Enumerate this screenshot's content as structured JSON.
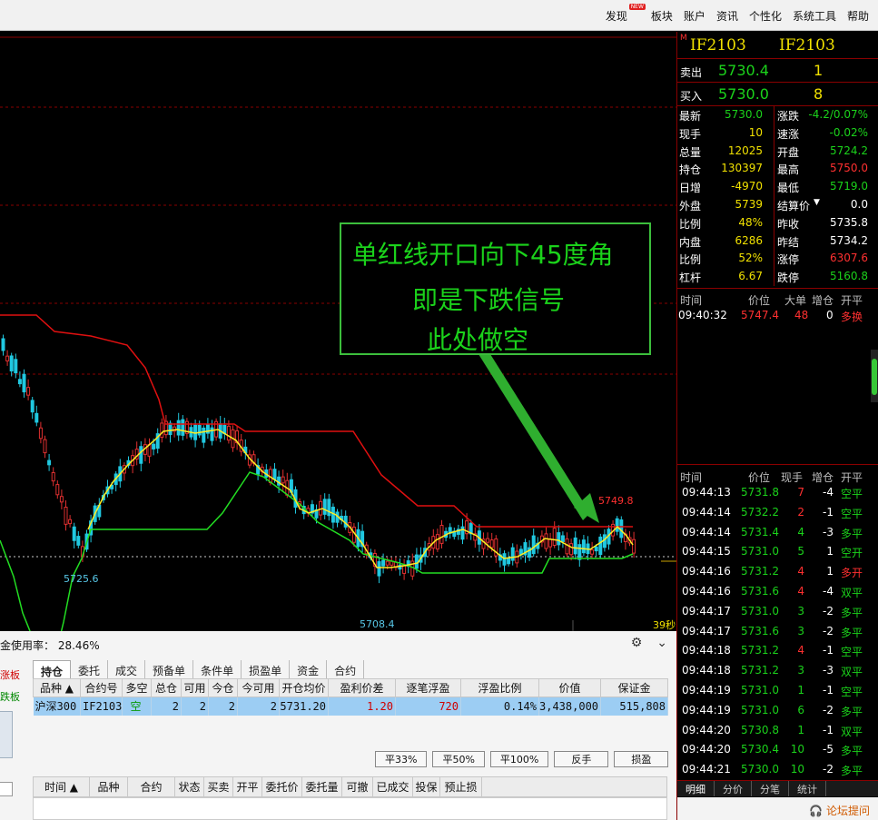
{
  "menu": [
    "发现",
    "板块",
    "账户",
    "资讯",
    "个性化",
    "系统工具",
    "帮助"
  ],
  "new_badge": "NEW",
  "chart": {
    "annotation": [
      "单红线开口向下45度角",
      "即是下跌信号",
      "此处做空"
    ],
    "labels": {
      "high": "5749.8",
      "low_left": "5725.6",
      "low_mid": "5708.4",
      "countdown": "39秒"
    }
  },
  "quote": {
    "market_flag": "M",
    "code1": "IF2103",
    "code2": "IF2103",
    "sell": {
      "label": "卖出",
      "price": "5730.4",
      "volume": "1"
    },
    "buy": {
      "label": "买入",
      "price": "5730.0",
      "volume": "8"
    },
    "stats": [
      {
        "l1": "最新",
        "v1": "5730.0",
        "c1": "#1bd21b",
        "l2": "涨跌",
        "v2": "-4.2/0.07%",
        "c2": "#1bd21b"
      },
      {
        "l1": "现手",
        "v1": "10",
        "c1": "#f0e000",
        "l2": "速涨",
        "v2": "-0.02%",
        "c2": "#1bd21b"
      },
      {
        "l1": "总量",
        "v1": "12025",
        "c1": "#f0e000",
        "l2": "开盘",
        "v2": "5724.2",
        "c2": "#1bd21b"
      },
      {
        "l1": "持仓",
        "v1": "130397",
        "c1": "#f0e000",
        "l2": "最高",
        "v2": "5750.0",
        "c2": "#ff3030"
      },
      {
        "l1": "日增",
        "v1": "-4970",
        "c1": "#f0e000",
        "l2": "最低",
        "v2": "5719.0",
        "c2": "#1bd21b"
      },
      {
        "l1": "外盘",
        "v1": "5739",
        "c1": "#f0e000",
        "l2": "结算价",
        "v2": "0.0",
        "c2": "#ffffff"
      },
      {
        "l1": "比例",
        "v1": "48%",
        "c1": "#f0e000",
        "l2": "昨收",
        "v2": "5735.8",
        "c2": "#ffffff"
      },
      {
        "l1": "内盘",
        "v1": "6286",
        "c1": "#f0e000",
        "l2": "昨结",
        "v2": "5734.2",
        "c2": "#ffffff"
      },
      {
        "l1": "比例",
        "v1": "52%",
        "c1": "#f0e000",
        "l2": "涨停",
        "v2": "6307.6",
        "c2": "#ff3030"
      },
      {
        "l1": "杠杆",
        "v1": "6.67",
        "c1": "#f0e000",
        "l2": "跌停",
        "v2": "5160.8",
        "c2": "#1bd21b"
      }
    ],
    "big_header": [
      "时间",
      "价位",
      "大单",
      "增仓",
      "开平"
    ],
    "big_row": {
      "time": "09:40:32",
      "price": "5747.4",
      "vol": "48",
      "inc": "0",
      "type": "多换"
    },
    "tick_header": [
      "时间",
      "价位",
      "现手",
      "增仓",
      "开平"
    ],
    "ticks": [
      {
        "time": "09:44:13",
        "price": "5731.8",
        "vol": "7",
        "inc": "-4",
        "type": "空平",
        "vc": "#ff3030",
        "tc": "#1bd21b"
      },
      {
        "time": "09:44:14",
        "price": "5732.2",
        "vol": "2",
        "inc": "-1",
        "type": "空平",
        "vc": "#ff3030",
        "tc": "#1bd21b"
      },
      {
        "time": "09:44:14",
        "price": "5731.4",
        "vol": "4",
        "inc": "-3",
        "type": "多平",
        "vc": "#1bd21b",
        "tc": "#1bd21b"
      },
      {
        "time": "09:44:15",
        "price": "5731.0",
        "vol": "5",
        "inc": "1",
        "type": "空开",
        "vc": "#1bd21b",
        "tc": "#1bd21b"
      },
      {
        "time": "09:44:16",
        "price": "5731.2",
        "vol": "4",
        "inc": "1",
        "type": "多开",
        "vc": "#ff3030",
        "tc": "#ff3030"
      },
      {
        "time": "09:44:16",
        "price": "5731.6",
        "vol": "4",
        "inc": "-4",
        "type": "双平",
        "vc": "#ff3030",
        "tc": "#1bd21b"
      },
      {
        "time": "09:44:17",
        "price": "5731.0",
        "vol": "3",
        "inc": "-2",
        "type": "多平",
        "vc": "#1bd21b",
        "tc": "#1bd21b"
      },
      {
        "time": "09:44:17",
        "price": "5731.6",
        "vol": "3",
        "inc": "-2",
        "type": "多平",
        "vc": "#1bd21b",
        "tc": "#1bd21b"
      },
      {
        "time": "09:44:18",
        "price": "5731.2",
        "vol": "4",
        "inc": "-1",
        "type": "空平",
        "vc": "#ff3030",
        "tc": "#1bd21b"
      },
      {
        "time": "09:44:18",
        "price": "5731.2",
        "vol": "3",
        "inc": "-3",
        "type": "双平",
        "vc": "#1bd21b",
        "tc": "#1bd21b"
      },
      {
        "time": "09:44:19",
        "price": "5731.0",
        "vol": "1",
        "inc": "-1",
        "type": "空平",
        "vc": "#1bd21b",
        "tc": "#1bd21b"
      },
      {
        "time": "09:44:19",
        "price": "5731.0",
        "vol": "6",
        "inc": "-2",
        "type": "多平",
        "vc": "#1bd21b",
        "tc": "#1bd21b"
      },
      {
        "time": "09:44:20",
        "price": "5730.8",
        "vol": "1",
        "inc": "-1",
        "type": "双平",
        "vc": "#1bd21b",
        "tc": "#1bd21b"
      },
      {
        "time": "09:44:20",
        "price": "5730.4",
        "vol": "10",
        "inc": "-5",
        "type": "多平",
        "vc": "#1bd21b",
        "tc": "#1bd21b"
      },
      {
        "time": "09:44:21",
        "price": "5730.0",
        "vol": "10",
        "inc": "-2",
        "type": "多平",
        "vc": "#1bd21b",
        "tc": "#1bd21b"
      }
    ],
    "bottom_tabs": [
      "明细",
      "分价",
      "分笔",
      "统计"
    ],
    "forum_button": "论坛提问"
  },
  "trade": {
    "usage_label": "金使用率：",
    "usage_value": "28.46%",
    "tabs": [
      "持仓",
      "委托",
      "成交",
      "预备单",
      "条件单",
      "损盈单",
      "资金",
      "合约"
    ],
    "side_limit_up": "涨板",
    "side_limit_down": "跌板",
    "position_columns": [
      "品种 ▲",
      "合约号",
      "多空",
      "总仓",
      "可用",
      "今仓",
      "今可用",
      "开仓均价",
      "盈利价差",
      "逐笔浮盈",
      "浮盈比例",
      "价值",
      "保证金"
    ],
    "position_row": [
      "沪深300",
      "IF2103",
      "空",
      "2",
      "2",
      "2",
      "2",
      "5731.20",
      "1.20",
      "720",
      "0.14%",
      "3,438,000",
      "515,808"
    ],
    "buttons": [
      "平33%",
      "平50%",
      "平100%",
      "反手",
      "损盈"
    ],
    "order_columns": [
      "时间 ▲",
      "品种",
      "合约",
      "状态",
      "买卖",
      "开平",
      "委托价",
      "委托量",
      "可撤",
      "已成交",
      "投保",
      "预止损"
    ]
  }
}
